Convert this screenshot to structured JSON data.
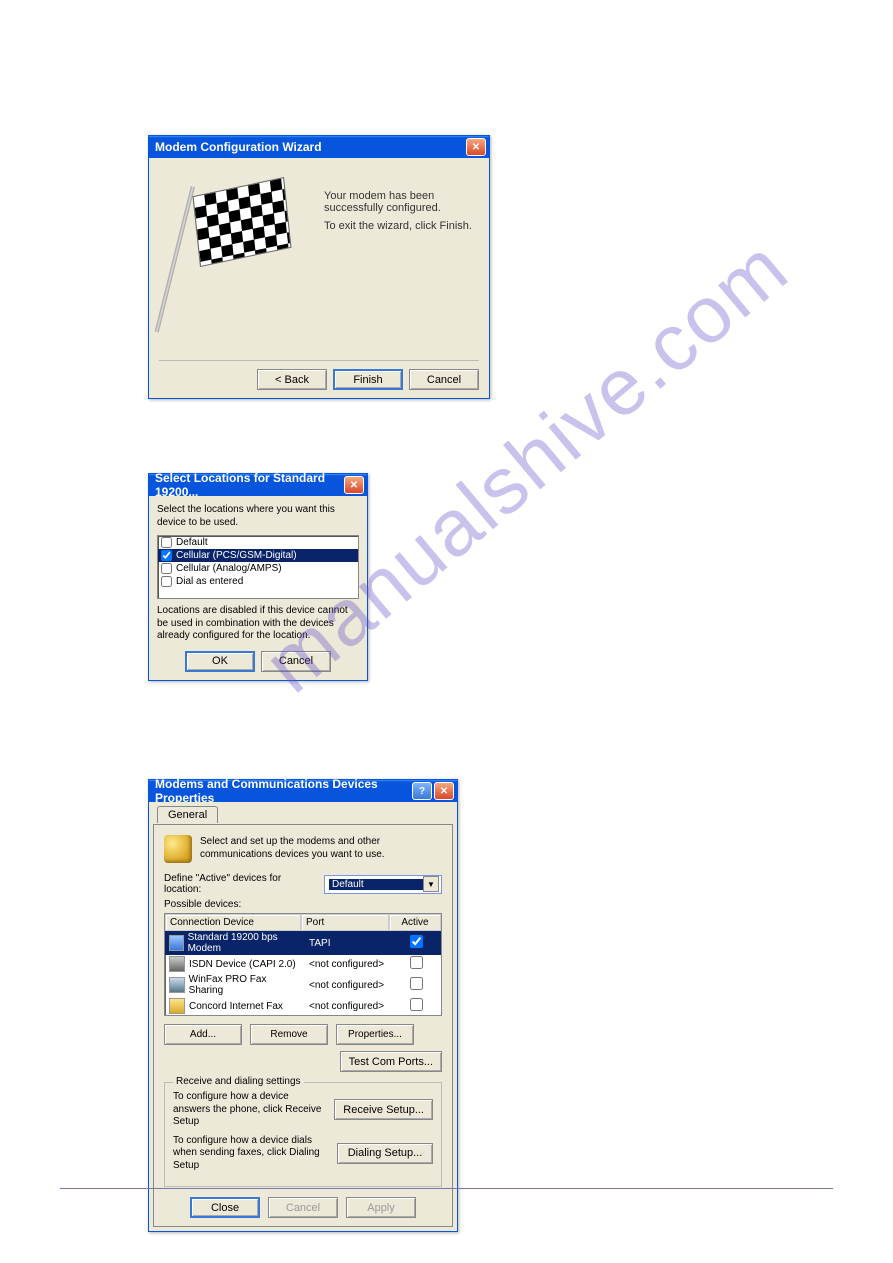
{
  "dialog1": {
    "title": "Modem Configuration Wizard",
    "msg_success": "Your modem has been successfully configured.",
    "msg_exit": "To exit the wizard, click Finish.",
    "back": "< Back",
    "finish": "Finish",
    "cancel": "Cancel"
  },
  "dialog2": {
    "title": "Select Locations for Standard 19200...",
    "instruction": "Select the locations where you want this device to be used.",
    "items": [
      {
        "label": "Default",
        "checked": false,
        "selected": false
      },
      {
        "label": "Cellular (PCS/GSM-Digital)",
        "checked": true,
        "selected": true
      },
      {
        "label": "Cellular (Analog/AMPS)",
        "checked": false,
        "selected": false
      },
      {
        "label": "Dial as entered",
        "checked": false,
        "selected": false
      }
    ],
    "note": "Locations are disabled if this device cannot be used in combination with the devices already configured for the location.",
    "ok": "OK",
    "cancel": "Cancel"
  },
  "dialog3": {
    "title": "Modems and Communications Devices Properties",
    "tab": "General",
    "header_text": "Select and set up the modems and other communications devices you want to use.",
    "define_label": "Define \"Active\" devices for location:",
    "location_value": "Default",
    "possible_label": "Possible devices:",
    "columns": {
      "conn": "Connection Device",
      "port": "Port",
      "active": "Active"
    },
    "rows": [
      {
        "name": "Standard 19200 bps Modem",
        "port": "TAPI",
        "active": true,
        "selected": true,
        "icon": "modem"
      },
      {
        "name": "ISDN Device (CAPI 2.0)",
        "port": "<not configured>",
        "active": false,
        "selected": false,
        "icon": "isdn"
      },
      {
        "name": "WinFax PRO Fax Sharing",
        "port": "<not configured>",
        "active": false,
        "selected": false,
        "icon": "fax"
      },
      {
        "name": "Concord Internet Fax",
        "port": "<not configured>",
        "active": false,
        "selected": false,
        "icon": "concord"
      }
    ],
    "add": "Add...",
    "remove": "Remove",
    "properties": "Properties...",
    "test_com": "Test Com Ports...",
    "group_title": "Receive and dialing settings",
    "recv_text": "To configure how a device answers the phone, click Receive Setup",
    "recv_btn": "Receive Setup...",
    "dial_text": "To configure how a device dials when sending faxes, click Dialing Setup",
    "dial_btn": "Dialing Setup...",
    "close": "Close",
    "cancel": "Cancel",
    "apply": "Apply"
  },
  "watermark": "manualshive.com"
}
